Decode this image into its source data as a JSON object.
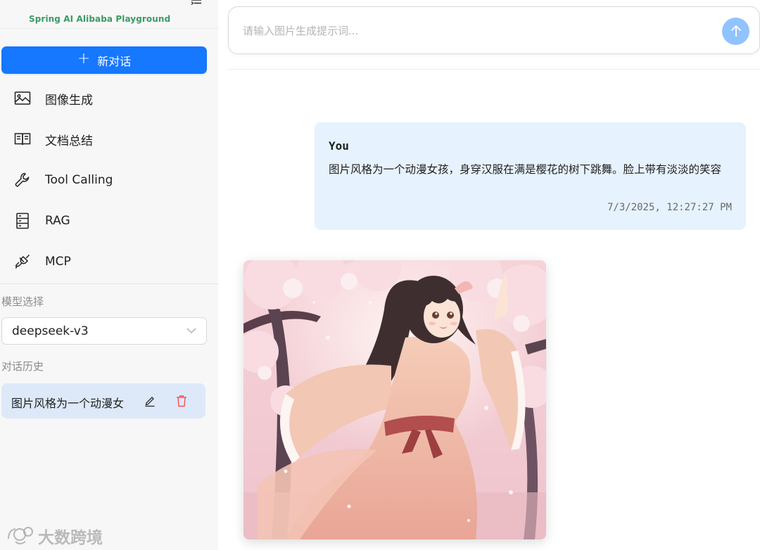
{
  "app": {
    "title": "Spring AI Alibaba Playground"
  },
  "sidebar": {
    "new_chat_label": "新对话",
    "items": [
      {
        "label": "图像生成",
        "icon": "image-icon"
      },
      {
        "label": "文档总结",
        "icon": "book-icon"
      },
      {
        "label": "Tool Calling",
        "icon": "wrench-icon"
      },
      {
        "label": "RAG",
        "icon": "database-icon"
      },
      {
        "label": "MCP",
        "icon": "plug-icon"
      }
    ],
    "model_label": "模型选择",
    "model_value": "deepseek-v3",
    "history_label": "对话历史",
    "history": [
      {
        "title": "图片风格为一个动漫女"
      }
    ]
  },
  "main": {
    "prompt_placeholder": "请输入图片生成提示词...",
    "prompt_value": "",
    "messages": [
      {
        "sender": "You",
        "content": "图片风格为一个动漫女孩，身穿汉服在满是樱花的树下跳舞。脸上带有淡淡的笑容",
        "time": "7/3/2025, 12:27:27 PM"
      }
    ]
  },
  "watermark": "大数跨境",
  "colors": {
    "primary": "#1677ff",
    "send_disabled": "#91c3ff",
    "user_bubble": "#e6f2fd",
    "history_selected": "#dde9f9",
    "logo_text": "#3c9a63",
    "delete": "#ff4d4f"
  }
}
